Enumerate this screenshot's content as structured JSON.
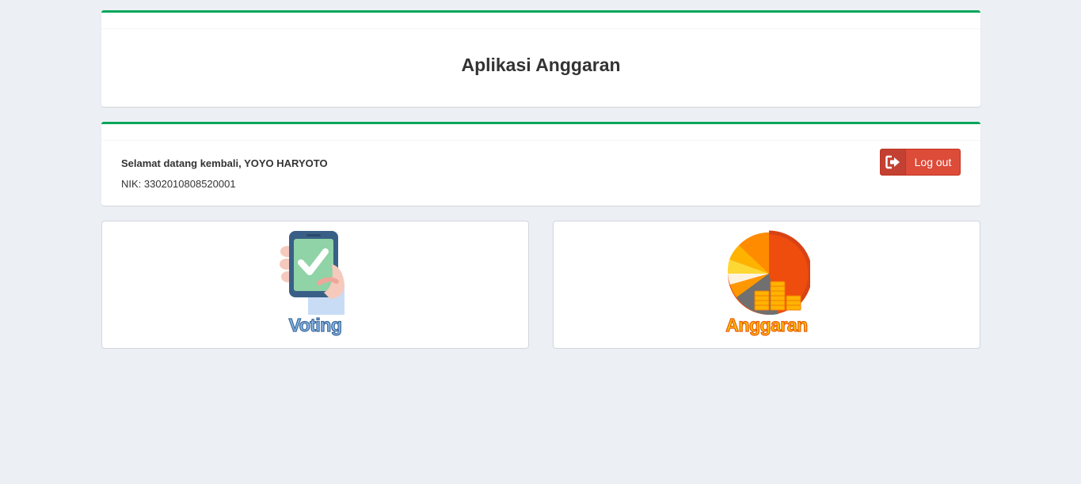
{
  "header": {
    "title": "Aplikasi Anggaran"
  },
  "user": {
    "welcome": "Selamat datang kembali, YOYO HARYOTO",
    "nik": "NIK: 3302010808520001",
    "logout_label": "Log out"
  },
  "menu": [
    {
      "label": "Voting",
      "icon": "voting-phone-icon"
    },
    {
      "label": "Anggaran",
      "icon": "budget-pie-icon"
    }
  ],
  "colors": {
    "accent": "#00a65a",
    "danger": "#dd4b39",
    "background": "#ecf0f5"
  }
}
